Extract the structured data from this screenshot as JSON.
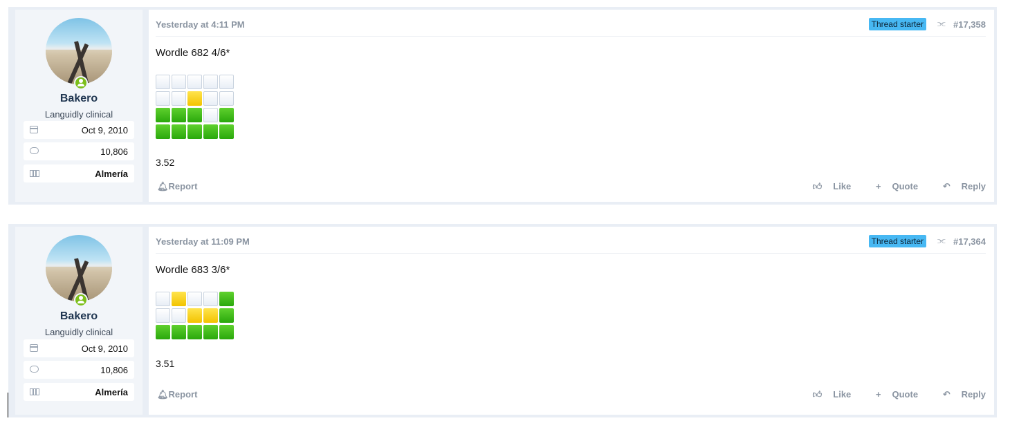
{
  "posts": [
    {
      "user": {
        "name": "Bakero",
        "title": "Languidly clinical",
        "joined": "Oct 9, 2010",
        "messages": "10,806",
        "location": "Almería"
      },
      "date": "Yesterday at 4:11 PM",
      "badge": "Thread starter",
      "number": "#17,358",
      "title": "Wordle 682 4/6*",
      "grid": [
        [
          "w",
          "w",
          "w",
          "w",
          "w"
        ],
        [
          "w",
          "w",
          "y",
          "w",
          "w"
        ],
        [
          "g",
          "g",
          "g",
          "w",
          "g"
        ],
        [
          "g",
          "g",
          "g",
          "g",
          "g"
        ]
      ],
      "score": "3.52",
      "report": "Report",
      "like": "Like",
      "quote": "Quote",
      "reply": "Reply"
    },
    {
      "user": {
        "name": "Bakero",
        "title": "Languidly clinical",
        "joined": "Oct 9, 2010",
        "messages": "10,806",
        "location": "Almería"
      },
      "date": "Yesterday at 11:09 PM",
      "badge": "Thread starter",
      "number": "#17,364",
      "title": "Wordle 683 3/6*",
      "grid": [
        [
          "w",
          "y",
          "w",
          "w",
          "g"
        ],
        [
          "w",
          "w",
          "y",
          "y",
          "g"
        ],
        [
          "g",
          "g",
          "g",
          "g",
          "g"
        ]
      ],
      "score": "3.51",
      "report": "Report",
      "like": "Like",
      "quote": "Quote",
      "reply": "Reply"
    }
  ],
  "colors": {
    "badge": "#47b8f3",
    "green": "#2aa80c",
    "yellow": "#f2c300",
    "online": "#7cbf1a"
  },
  "icons": {
    "joined": "calendar-icon",
    "messages": "messages-icon",
    "location": "map-icon",
    "share": "share-icon",
    "report": "bell-icon",
    "like": "thumbs-up-icon",
    "quote": "plus-icon",
    "reply": "reply-icon"
  }
}
